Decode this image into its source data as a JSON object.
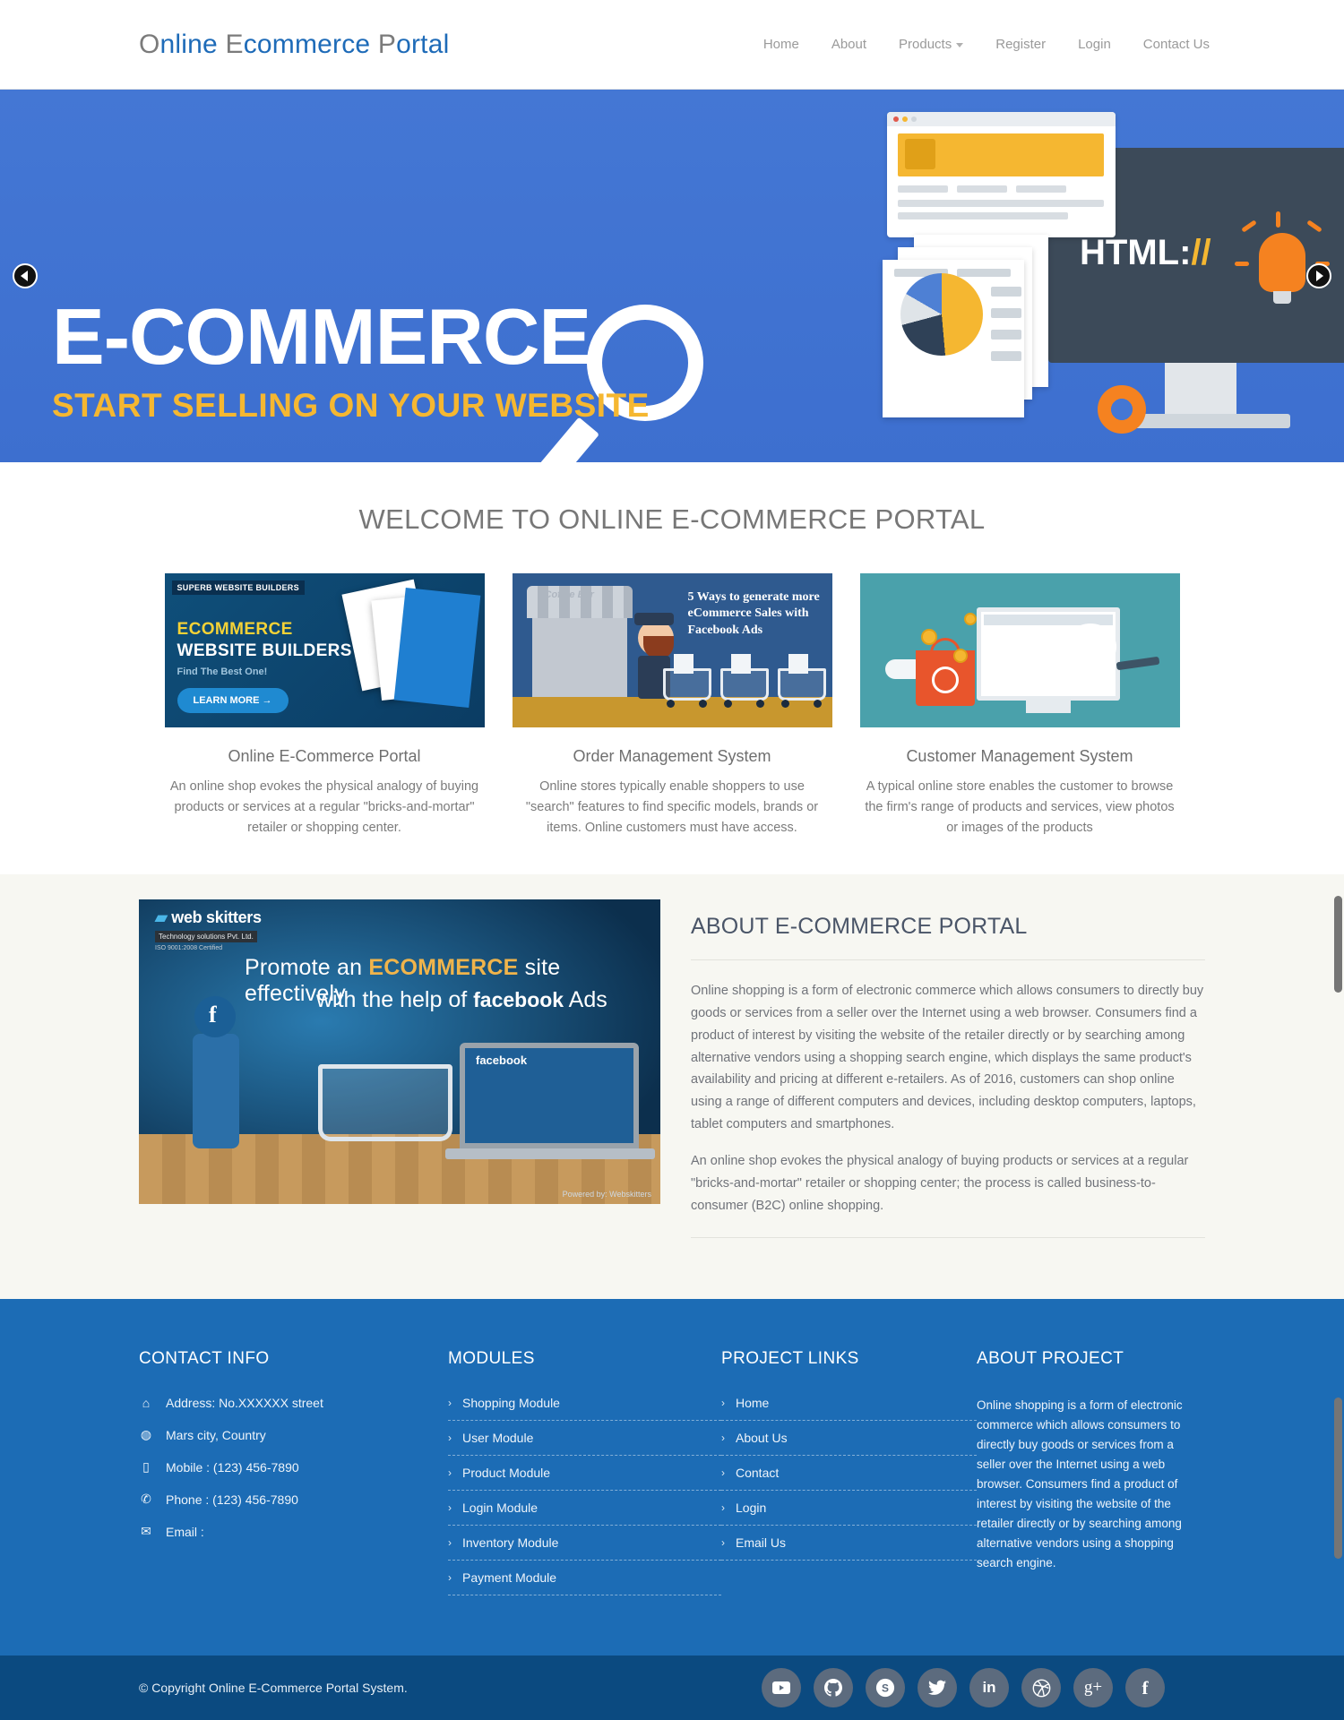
{
  "header": {
    "logo": {
      "parts": [
        {
          "t": "O",
          "c": "gray"
        },
        {
          "t": "nline ",
          "c": "blue"
        },
        {
          "t": "E",
          "c": "gray"
        },
        {
          "t": "commerce ",
          "c": "blue"
        },
        {
          "t": "P",
          "c": "gray"
        },
        {
          "t": "ortal",
          "c": "blue"
        }
      ],
      "full_text": "Online Ecommerce Portal"
    },
    "nav": [
      {
        "label": "Home",
        "dropdown": false
      },
      {
        "label": "About",
        "dropdown": false
      },
      {
        "label": "Products",
        "dropdown": true
      },
      {
        "label": "Register",
        "dropdown": false
      },
      {
        "label": "Login",
        "dropdown": false
      },
      {
        "label": "Contact Us",
        "dropdown": false
      }
    ]
  },
  "hero": {
    "title": "E-COMMERCE",
    "subtitle": "START SELLING ON YOUR WEBSITE",
    "monitor_text": "HTML:",
    "monitor_text_accent": "//",
    "prev_label": "previous-slide",
    "next_label": "next-slide",
    "bg_color": "#3d6fcf",
    "accent_color": "#f5b731"
  },
  "welcome": {
    "title": "WELCOME TO ONLINE E-COMMERCE PORTAL",
    "cards": [
      {
        "title": "Online E-Commerce Portal",
        "text": "An online shop evokes the physical analogy of buying products or services at a regular \"bricks-and-mortar\" retailer or shopping center.",
        "image": {
          "kind": "ecommerce-website-builders-banner",
          "badge": "SUPERB WEBSITE BUILDERS",
          "line1": "ECOMMERCE",
          "line2": "WEBSITE BUILDERS",
          "line3": "Find The Best One!",
          "button": "LEARN MORE →"
        }
      },
      {
        "title": "Order Management System",
        "text": "Online stores typically enable shoppers to use \"search\" features to find specific models, brands or items. Online customers must have access.",
        "image": {
          "kind": "facebook-ads-shopping-carts-banner",
          "shop_sign": "Coffee Bar",
          "headline": "5 Ways to generate more eCommerce Sales with Facebook Ads"
        }
      },
      {
        "title": "Customer Management System",
        "text": "A typical online store enables the customer to browse the firm's range of products and services, view photos or images of the products",
        "image": {
          "kind": "online-shopping-monitor-bag-illustration"
        }
      }
    ]
  },
  "about": {
    "title": "ABOUT E-COMMERCE PORTAL",
    "image": {
      "kind": "webskitters-facebook-ads-banner",
      "brand": "web skitters",
      "brand_sub": "Technology solutions Pvt. Ltd.",
      "brand_iso": "ISO 9001:2008 Certified",
      "promo_1_a": "Promote an ",
      "promo_1_b": "ECOMMERCE",
      "promo_1_c": " site effectively",
      "promo_2_a": "with the help of ",
      "promo_2_b": "facebook",
      "promo_2_c": " Ads",
      "credit": "Powered by: Webskitters"
    },
    "paragraphs": [
      "Online shopping is a form of electronic commerce which allows consumers to directly buy goods or services from a seller over the Internet using a web browser. Consumers find a product of interest by visiting the website of the retailer directly or by searching among alternative vendors using a shopping search engine, which displays the same product's availability and pricing at different e-retailers. As of 2016, customers can shop online using a range of different computers and devices, including desktop computers, laptops, tablet computers and smartphones.",
      "An online shop evokes the physical analogy of buying products or services at a regular \"bricks-and-mortar\" retailer or shopping center; the process is called business-to-consumer (B2C) online shopping."
    ]
  },
  "footer": {
    "contact": {
      "heading": "CONTACT INFO",
      "items": [
        {
          "icon": "home-icon",
          "glyph": "⌂",
          "text": "Address: No.XXXXXX street"
        },
        {
          "icon": "globe-icon",
          "glyph": "◍",
          "text": "Mars city, Country"
        },
        {
          "icon": "mobile-icon",
          "glyph": "▯",
          "text": "Mobile : (123) 456-7890"
        },
        {
          "icon": "phone-icon",
          "glyph": "✆",
          "text": "Phone : (123) 456-7890"
        },
        {
          "icon": "envelope-icon",
          "glyph": "✉",
          "text": "Email :"
        }
      ]
    },
    "modules": {
      "heading": "MODULES",
      "items": [
        "Shopping Module",
        "User Module",
        "Product Module",
        "Login Module",
        "Inventory Module",
        "Payment Module"
      ]
    },
    "project_links": {
      "heading": "PROJECT LINKS",
      "items": [
        "Home",
        "About Us",
        "Contact",
        "Login",
        "Email Us"
      ]
    },
    "about_project": {
      "heading": "ABOUT PROJECT",
      "text": "Online shopping is a form of electronic commerce which allows consumers to directly buy goods or services from a seller over the Internet using a web browser. Consumers find a product of interest by visiting the website of the retailer directly or by searching among alternative vendors using a shopping search engine."
    },
    "bottom": {
      "copyright": "© Copyright Online E-Commerce Portal System.",
      "socials": [
        {
          "name": "youtube-icon",
          "label": "You"
        },
        {
          "name": "github-icon",
          "label": "github"
        },
        {
          "name": "skype-icon",
          "label": "S"
        },
        {
          "name": "twitter-icon",
          "label": "twitter"
        },
        {
          "name": "linkedin-icon",
          "label": "in"
        },
        {
          "name": "dribbble-icon",
          "label": "dribbble"
        },
        {
          "name": "google-plus-icon",
          "label": "g+"
        },
        {
          "name": "facebook-icon",
          "label": "f"
        }
      ]
    },
    "bg_color": "#1c6cb5",
    "bar_color": "#0b4a80"
  }
}
